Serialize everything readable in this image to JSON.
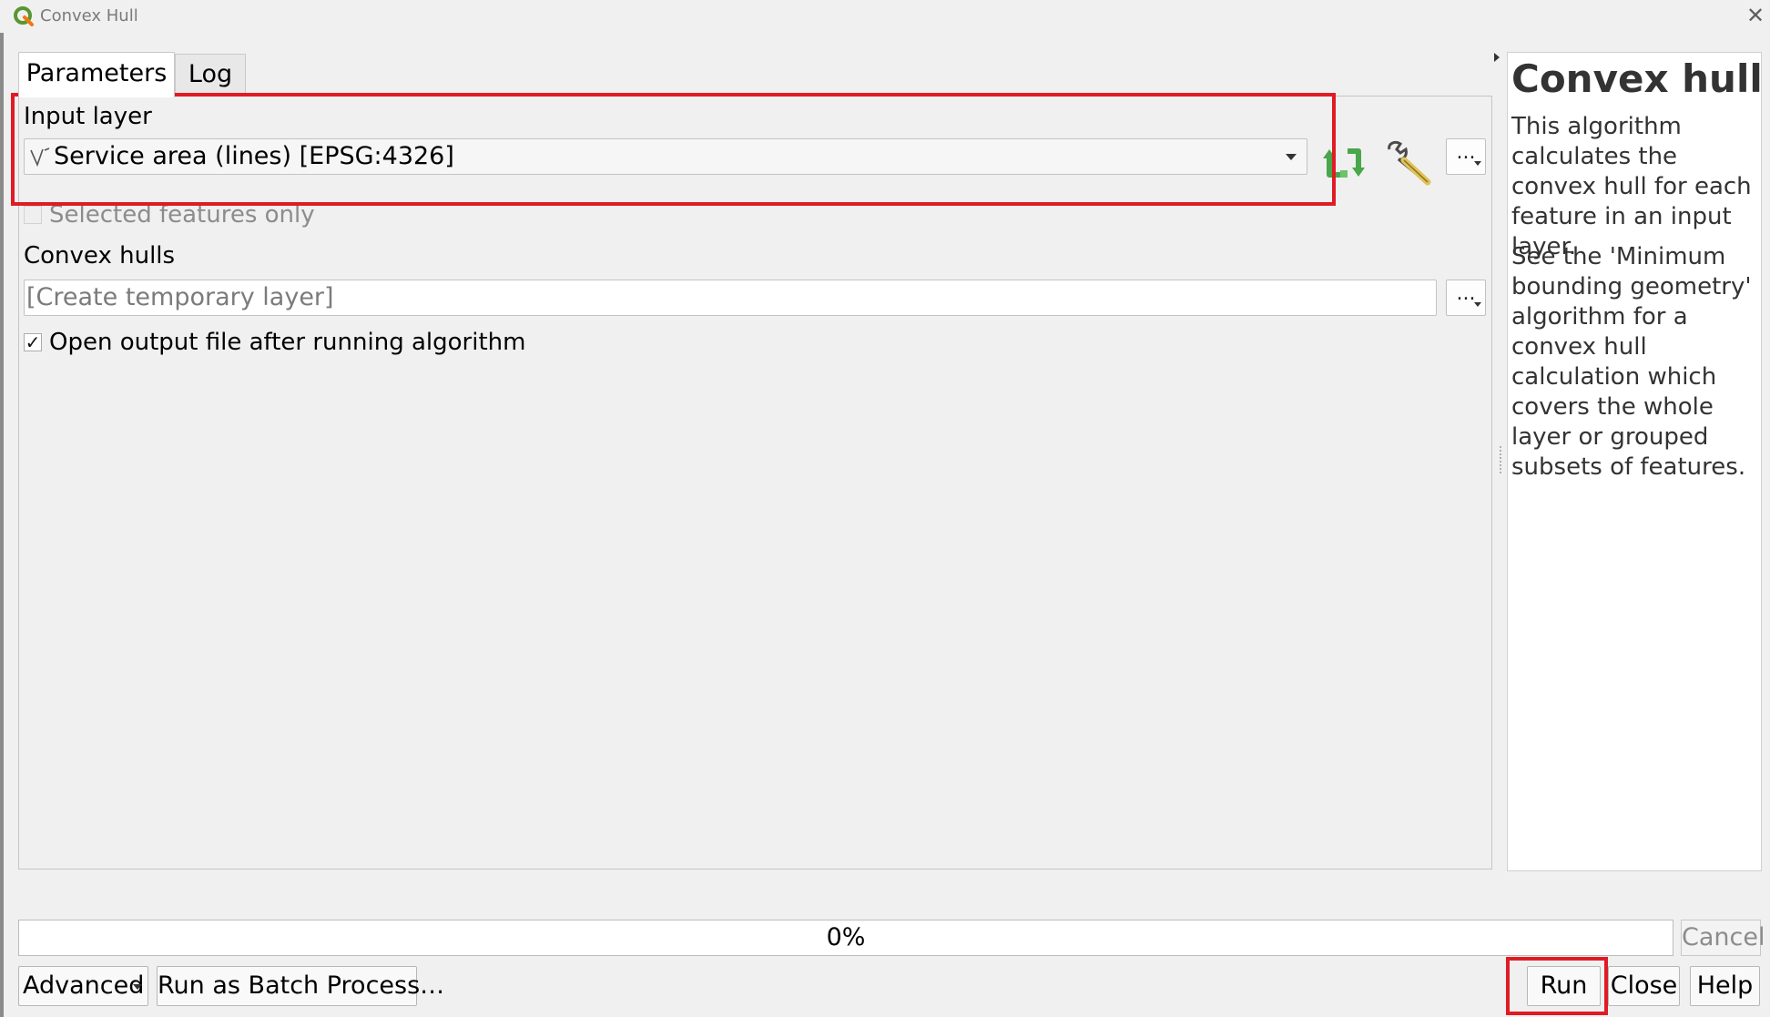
{
  "window": {
    "title": "Convex Hull",
    "close_glyph": "✕"
  },
  "tabs": [
    {
      "label": "Parameters",
      "active": true
    },
    {
      "label": "Log",
      "active": false
    }
  ],
  "parameters": {
    "input_layer": {
      "label": "Input layer",
      "value": "Service area (lines) [EPSG:4326]",
      "layer_icon": "line-layer-icon",
      "dots_label": "..."
    },
    "selected_features_only": {
      "label": "Selected features only",
      "checked": false,
      "enabled": false
    },
    "output": {
      "label": "Convex hulls",
      "placeholder": "[Create temporary layer]",
      "dots_label": "..."
    },
    "open_output": {
      "label": "Open output file after running algorithm",
      "checked": true,
      "check_glyph": "✓"
    }
  },
  "help": {
    "title": "Convex hull",
    "paragraphs": [
      "This algorithm calculates the convex hull for each feature in an input layer.",
      "See the 'Minimum bounding geometry' algorithm for a convex hull calculation which covers the whole layer or grouped subsets of features."
    ]
  },
  "progress": {
    "value_percent": 0,
    "label": "0%"
  },
  "buttons": {
    "cancel": "Cancel",
    "advanced": "Advanced",
    "batch": "Run as Batch Process…",
    "run": "Run",
    "close": "Close",
    "help": "Help"
  },
  "colors": {
    "highlight": "#e01b24",
    "iterate_icon": "#5cb85c",
    "window_bg": "#f0f0f0"
  }
}
